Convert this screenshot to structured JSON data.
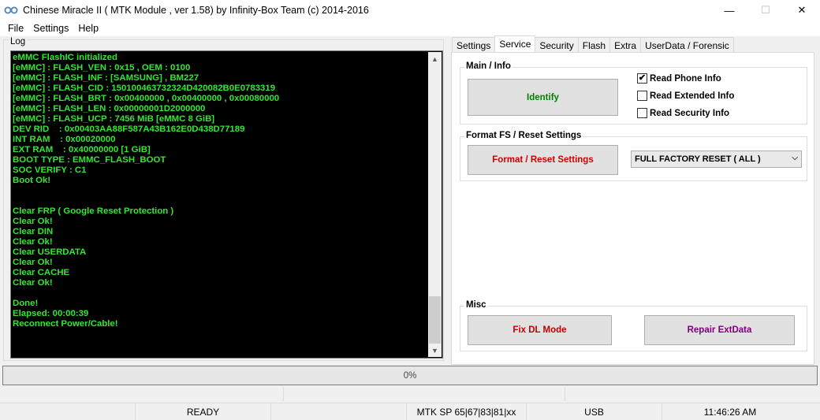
{
  "window": {
    "title": "Chinese Miracle II ( MTK Module , ver 1.58) by Infinity-Box Team (c) 2014-2016",
    "minimize": "—",
    "maximize": "☐",
    "close": "✕"
  },
  "menu": [
    "File",
    "Settings",
    "Help"
  ],
  "log": {
    "label": "Log",
    "lines": [
      "eMMC FlashIC initialized",
      "[eMMC] : FLASH_VEN : 0x15 , OEM : 0100",
      "[eMMC] : FLASH_INF : [SAMSUNG] , BM227",
      "[eMMC] : FLASH_CID : 150100463732324D420082B0E0783319",
      "[eMMC] : FLASH_BRT : 0x00400000 , 0x00400000 , 0x00080000",
      "[eMMC] : FLASH_LEN : 0x00000001D2000000",
      "[eMMC] : FLASH_UCP : 7456 MiB [eMMC 8 GiB]",
      "DEV RID    : 0x00403AA88F587A43B162E0D438D77189",
      "INT RAM    : 0x00020000",
      "EXT RAM    : 0x40000000 [1 GiB]",
      "BOOT TYPE : EMMC_FLASH_BOOT",
      "SOC VERIFY : C1",
      "Boot Ok!",
      "",
      "",
      "Clear FRP ( Google Reset Protection )",
      "Clear Ok!",
      "Clear DIN",
      "Clear Ok!",
      "Clear USERDATA",
      "Clear Ok!",
      "Clear CACHE",
      "Clear Ok!",
      "",
      "Done!",
      "Elapsed: 00:00:39",
      "Reconnect Power/Cable!"
    ]
  },
  "tabs": [
    "Settings",
    "Service",
    "Security",
    "Flash",
    "Extra",
    "UserData / Forensic"
  ],
  "active_tab": "Service",
  "main_info": {
    "legend": "Main / Info",
    "identify_label": "Identify",
    "checkboxes": [
      {
        "label": "Read Phone Info",
        "checked": true
      },
      {
        "label": "Read Extended Info",
        "checked": false
      },
      {
        "label": "Read Security Info",
        "checked": false
      }
    ]
  },
  "format": {
    "legend": "Format FS / Reset Settings",
    "button_label": "Format / Reset Settings",
    "select_value": "FULL FACTORY RESET ( ALL )"
  },
  "misc": {
    "legend": "Misc",
    "fix_dl_label": "Fix DL Mode",
    "repair_label": "Repair ExtData"
  },
  "progress": {
    "text": "0%",
    "value": 0
  },
  "status": {
    "ready": "READY",
    "platform": "MTK SP 65|67|83|81|xx",
    "connection": "USB",
    "time": "11:46:26 AM"
  },
  "colors": {
    "log_text": "#32e632",
    "identify_text": "#008000",
    "format_text": "#d00000",
    "fix_dl_text": "#c00000",
    "repair_text": "#800080"
  }
}
